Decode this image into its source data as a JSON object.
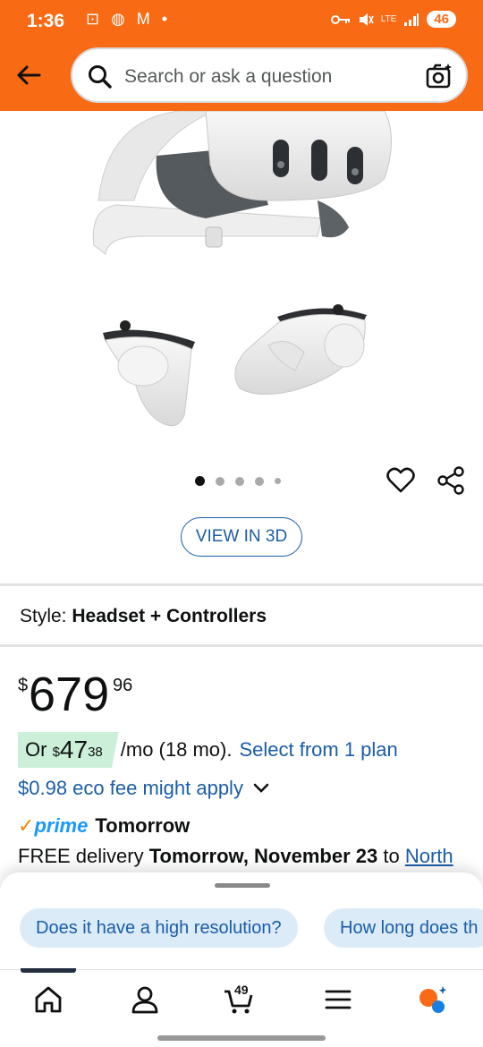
{
  "status_bar": {
    "time": "1:36",
    "left_icons": "⊡ ◍ M •",
    "signal_text": "LTE",
    "battery": "46"
  },
  "header": {
    "search_placeholder": "Search or ask a question",
    "back_icon": "arrow-left-icon",
    "camera_icon": "camera-search-icon",
    "accent_color": "#f96a14"
  },
  "gallery": {
    "image_count": 5,
    "active_index": 0,
    "view_3d_label": "VIEW IN 3D"
  },
  "style": {
    "label": "Style:",
    "value": "Headset + Controllers"
  },
  "price": {
    "currency": "$",
    "whole": "679",
    "fraction": "96"
  },
  "installment": {
    "prefix": "Or",
    "currency": "$",
    "whole": "47",
    "fraction": "38",
    "suffix": "/mo (18 mo).",
    "link": "Select from 1 plan"
  },
  "eco_fee": "$0.98 eco fee might apply",
  "prime": {
    "check": "✓",
    "brand": "prime",
    "speed": "Tomorrow"
  },
  "delivery": {
    "prefix": "FREE delivery",
    "date": "Tomorrow, November 23",
    "to": "to",
    "location": "North"
  },
  "questions": [
    "Does it have a high resolution?",
    "How long does th"
  ],
  "nav": {
    "cart_count": "49",
    "items": [
      "home-icon",
      "account-icon",
      "cart-icon",
      "menu-icon",
      "rufus-icon"
    ]
  }
}
